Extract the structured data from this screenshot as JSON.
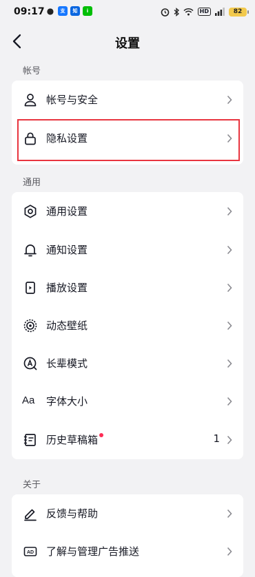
{
  "status_bar": {
    "time": "09:17",
    "battery": "82",
    "hd_label": "HD"
  },
  "header": {
    "title": "设置"
  },
  "sections": [
    {
      "label": "帐号",
      "items": [
        {
          "label": "帐号与安全",
          "icon": "person-icon"
        },
        {
          "label": "隐私设置",
          "icon": "lock-icon"
        }
      ]
    },
    {
      "label": "通用",
      "items": [
        {
          "label": "通用设置",
          "icon": "gear-icon"
        },
        {
          "label": "通知设置",
          "icon": "bell-icon"
        },
        {
          "label": "播放设置",
          "icon": "play-settings-icon"
        },
        {
          "label": "动态壁纸",
          "icon": "live-wallpaper-icon"
        },
        {
          "label": "长辈模式",
          "icon": "elder-mode-icon"
        },
        {
          "label": "字体大小",
          "icon": "font-size-icon",
          "glyph": "Aa"
        },
        {
          "label": "历史草稿箱",
          "icon": "drafts-icon",
          "value": "1",
          "has_badge": true
        }
      ]
    },
    {
      "label": "关于",
      "items": [
        {
          "label": "反馈与帮助",
          "icon": "pen-icon"
        },
        {
          "label": "了解与管理广告推送",
          "icon": "ad-icon",
          "glyph": "AD"
        }
      ]
    }
  ],
  "colors": {
    "highlight": "#e8353f",
    "badge": "#fe2c55",
    "background": "#f2f2f4"
  }
}
